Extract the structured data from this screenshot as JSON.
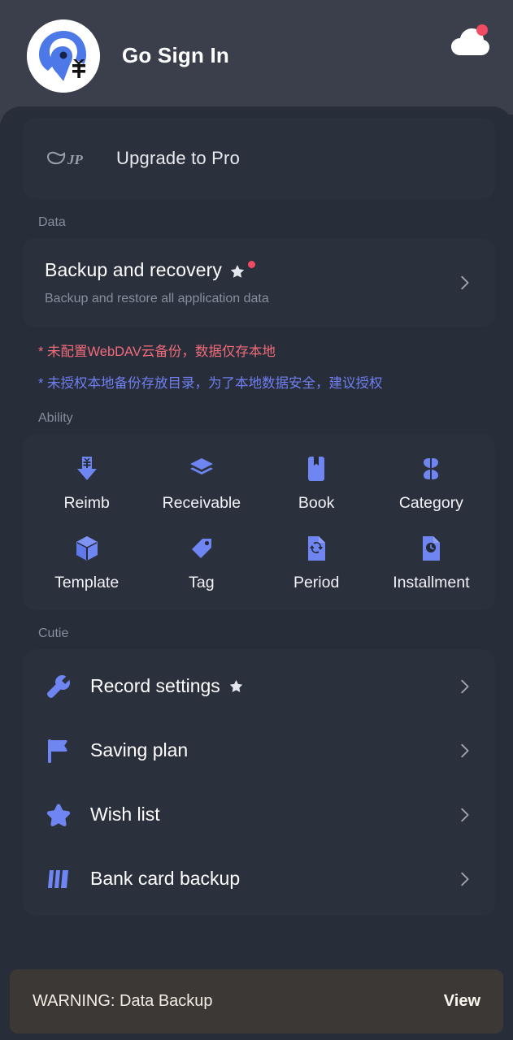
{
  "header": {
    "sign_in_label": "Go Sign In",
    "logo_icon": "app-logo-bird-yen",
    "cloud_icon": "cloud-sync-icon",
    "cloud_badge": "red-dot"
  },
  "pro_banner": {
    "badge_icon": "vip-badge-icon",
    "label": "Upgrade to Pro"
  },
  "data_section": {
    "label": "Data",
    "backup": {
      "title": "Backup and recovery",
      "subtitle": "Backup and restore all application data",
      "star_icon": "star-icon",
      "badge": "red-dot",
      "chevron": "chevron-right-icon"
    },
    "notes": [
      {
        "text": "* 未配置WebDAV云备份，数据仅存本地",
        "color": "#f26b7a"
      },
      {
        "text": "* 未授权本地备份存放目录，为了本地数据安全，建议授权",
        "color": "#6f7ff0"
      }
    ]
  },
  "ability_section": {
    "label": "Ability",
    "items": [
      {
        "label": "Reimb",
        "icon": "arrow-down-yen-icon"
      },
      {
        "label": "Receivable",
        "icon": "layers-icon"
      },
      {
        "label": "Book",
        "icon": "book-bookmark-icon"
      },
      {
        "label": "Category",
        "icon": "four-petal-grid-icon"
      },
      {
        "label": "Template",
        "icon": "cube-icon"
      },
      {
        "label": "Tag",
        "icon": "tag-icon"
      },
      {
        "label": "Period",
        "icon": "document-refresh-icon"
      },
      {
        "label": "Installment",
        "icon": "document-clock-icon"
      }
    ]
  },
  "cutie_section": {
    "label": "Cutie",
    "items": [
      {
        "label": "Record settings",
        "icon": "wrench-icon",
        "has_star": true,
        "chevron": "chevron-right-icon"
      },
      {
        "label": "Saving plan",
        "icon": "flag-icon",
        "has_star": false,
        "chevron": "chevron-right-icon"
      },
      {
        "label": "Wish list",
        "icon": "star-icon",
        "has_star": false,
        "chevron": "chevron-right-icon"
      },
      {
        "label": "Bank card backup",
        "icon": "card-bars-icon",
        "has_star": false,
        "chevron": "chevron-right-icon"
      }
    ]
  },
  "snackbar": {
    "message": "WARNING: Data Backup",
    "action_label": "View"
  },
  "colors": {
    "page_background": "#282d3a",
    "header_background": "#3a3f4b",
    "card_background": "#2b303d",
    "accent_blue": "#6f86f2",
    "muted_text": "#868d9b",
    "badge_red": "#ef4b63",
    "note_red": "#f26b7a",
    "note_blue": "#6f7ff0",
    "snackbar_background": "#3b3835"
  }
}
